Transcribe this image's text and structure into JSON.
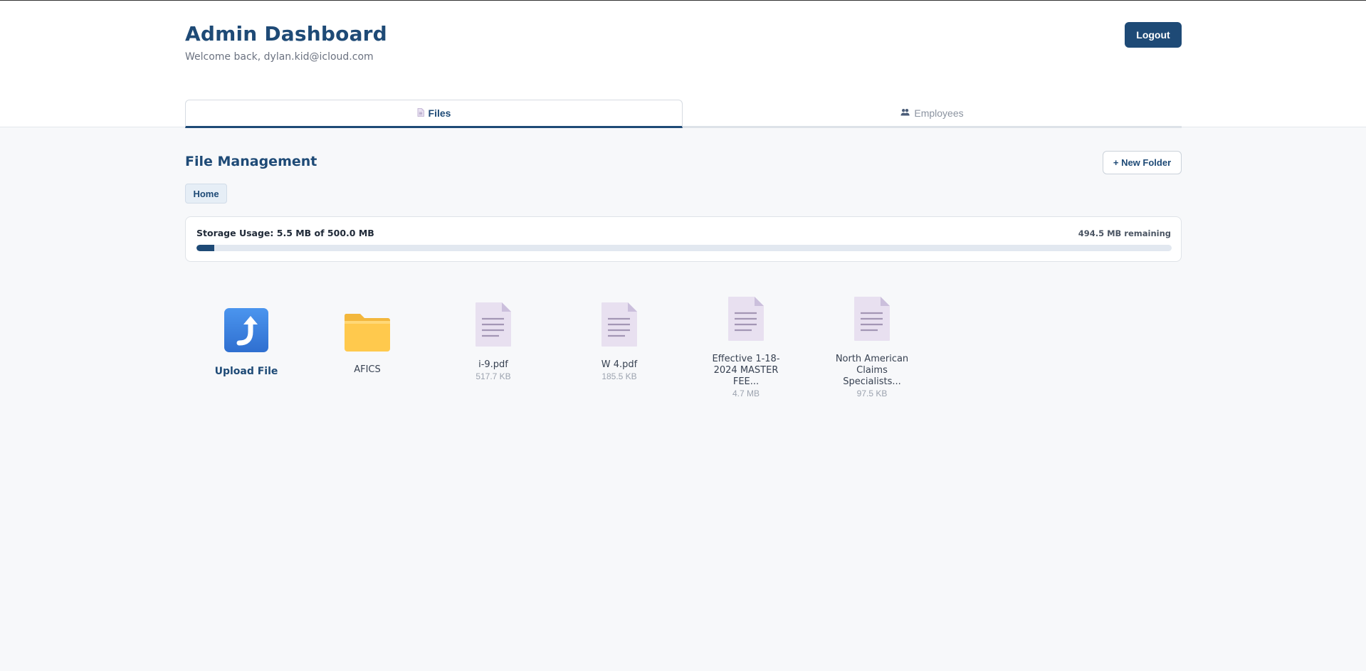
{
  "header": {
    "title": "Admin Dashboard",
    "welcome": "Welcome back, dylan.kid@icloud.com",
    "logout_label": "Logout"
  },
  "tabs": [
    {
      "label": "Files",
      "icon": "file-icon",
      "active": true
    },
    {
      "label": "Employees",
      "icon": "users-icon",
      "active": false
    }
  ],
  "main": {
    "section_title": "File Management",
    "new_folder_label": "+ New Folder",
    "breadcrumb": [
      "Home"
    ]
  },
  "storage": {
    "label": "Storage Usage: 5.5 MB of 500.0 MB",
    "remaining": "494.5 MB remaining",
    "used_fraction": 0.011
  },
  "grid": {
    "upload_label": "Upload File",
    "items": [
      {
        "type": "folder",
        "name": "AFICS",
        "size": ""
      },
      {
        "type": "file",
        "name": "i-9.pdf",
        "size": "517.7 KB"
      },
      {
        "type": "file",
        "name": "W 4.pdf",
        "size": "185.5 KB"
      },
      {
        "type": "file",
        "name": "Effective 1-18-2024 MASTER FEE...",
        "size": "4.7 MB"
      },
      {
        "type": "file",
        "name": "North American Claims Specialists...",
        "size": "97.5 KB"
      }
    ]
  },
  "colors": {
    "primary": "#1e4a76",
    "background": "#f7f8fa",
    "folder": "#ffc94d",
    "file": "#e6def0",
    "upload": "#3b82e0"
  }
}
